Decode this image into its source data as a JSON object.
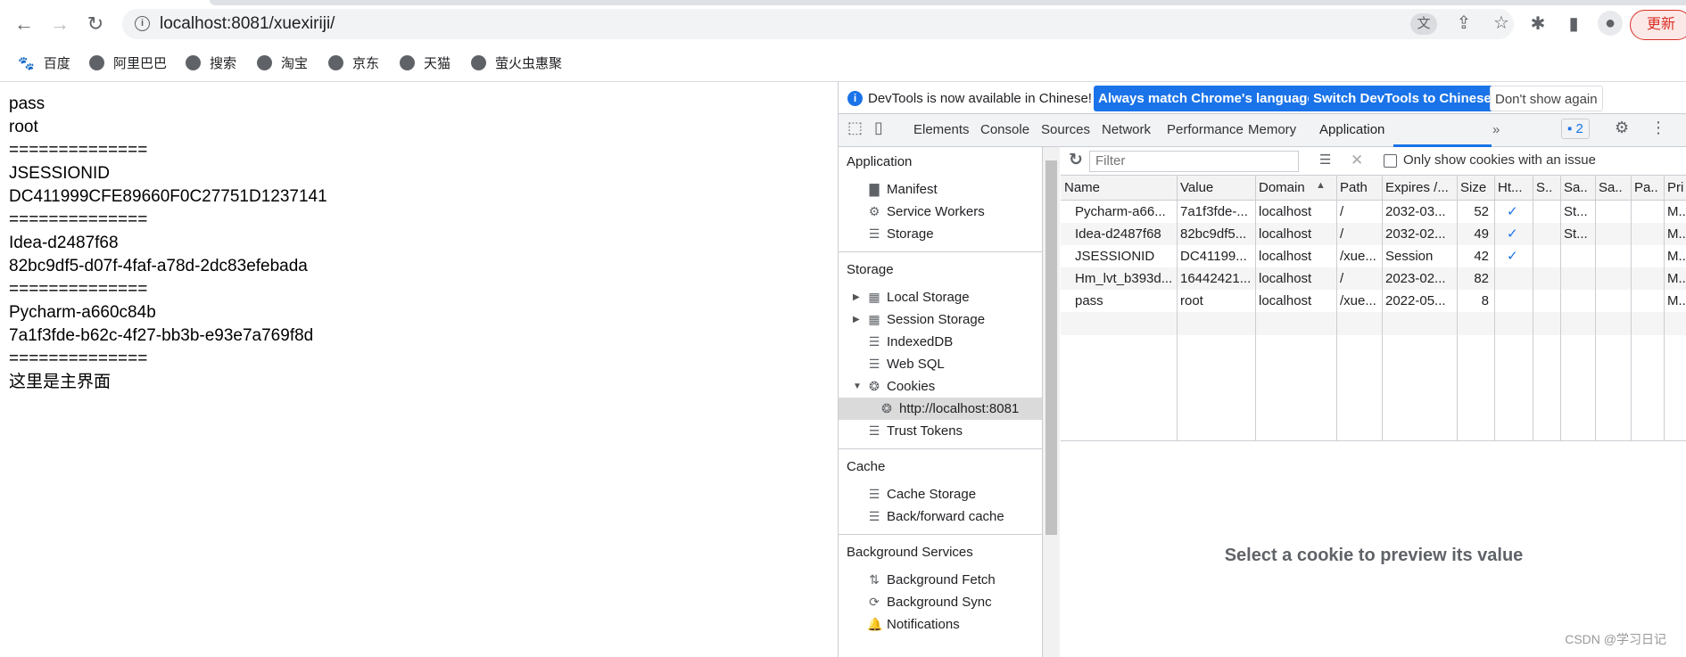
{
  "browser": {
    "url": "localhost:8081/xuexiriji/",
    "update_label": "更新",
    "bookmarks": [
      "百度",
      "阿里巴巴",
      "搜索",
      "淘宝",
      "京东",
      "天猫",
      "萤火虫惠聚"
    ]
  },
  "page": {
    "lines": [
      "pass",
      "root",
      "==============",
      "JSESSIONID",
      "DC411999CFE89660F0C27751D1237141",
      "==============",
      "Idea-d2487f68",
      "82bc9df5-d07f-4faf-a78d-2dc83efebada",
      "==============",
      "Pycharm-a660c84b",
      "7a1f3fde-b62c-4f27-bb3b-e93e7a769f8d",
      "==============",
      "这里是主界面"
    ]
  },
  "devtools": {
    "infobar": {
      "message": "DevTools is now available in Chinese!",
      "btn_match": "Always match Chrome's language",
      "btn_switch": "Switch DevTools to Chinese",
      "btn_dismiss": "Don't show again"
    },
    "tabs": [
      "Elements",
      "Console",
      "Sources",
      "Network",
      "Performance",
      "Memory",
      "Application"
    ],
    "active_tab": "Application",
    "issues_count": "2",
    "accent": "#1a73e8",
    "sidebar": {
      "sections": [
        {
          "title": "Application",
          "items": [
            {
              "label": "Manifest",
              "icon": "file-icon"
            },
            {
              "label": "Service Workers",
              "icon": "gear-icon"
            },
            {
              "label": "Storage",
              "icon": "database-icon"
            }
          ]
        },
        {
          "title": "Storage",
          "items": [
            {
              "label": "Local Storage",
              "icon": "grid-icon",
              "arrow": "▶"
            },
            {
              "label": "Session Storage",
              "icon": "grid-icon",
              "arrow": "▶"
            },
            {
              "label": "IndexedDB",
              "icon": "database-icon"
            },
            {
              "label": "Web SQL",
              "icon": "database-icon"
            },
            {
              "label": "Cookies",
              "icon": "cookie-icon",
              "arrow": "▼"
            },
            {
              "label": "http://localhost:8081",
              "icon": "cookie-icon",
              "child": true,
              "selected": true
            },
            {
              "label": "Trust Tokens",
              "icon": "database-icon"
            }
          ]
        },
        {
          "title": "Cache",
          "items": [
            {
              "label": "Cache Storage",
              "icon": "database-icon"
            },
            {
              "label": "Back/forward cache",
              "icon": "database-icon"
            }
          ]
        },
        {
          "title": "Background Services",
          "items": [
            {
              "label": "Background Fetch",
              "icon": "arrows-updown-icon"
            },
            {
              "label": "Background Sync",
              "icon": "sync-icon"
            },
            {
              "label": "Notifications",
              "icon": "bell-icon"
            }
          ]
        }
      ]
    },
    "cookies": {
      "filter_placeholder": "Filter",
      "only_issues_label": "Only show cookies with an issue",
      "columns": [
        "Name",
        "Value",
        "Domain",
        "Path",
        "Expires /...",
        "Size",
        "Ht...",
        "S..",
        "Sa..",
        "Sa..",
        "Pa..",
        "Pri"
      ],
      "sort_column": "Domain",
      "sort_dir": "ascending",
      "rows": [
        [
          "Pycharm-a66...",
          "7a1f3fde-...",
          "localhost",
          "/",
          "2032-03...",
          "52",
          "✓",
          "",
          "St...",
          "",
          "",
          "M.."
        ],
        [
          "Idea-d2487f68",
          "82bc9df5...",
          "localhost",
          "/",
          "2032-02...",
          "49",
          "✓",
          "",
          "St...",
          "",
          "",
          "M.."
        ],
        [
          "JSESSIONID",
          "DC41199...",
          "localhost",
          "/xue...",
          "Session",
          "42",
          "✓",
          "",
          "",
          "",
          "",
          "M.."
        ],
        [
          "Hm_lvt_b393d...",
          "16442421...",
          "localhost",
          "/",
          "2023-02...",
          "82",
          "",
          "",
          "",
          "",
          "",
          "M.."
        ],
        [
          "pass",
          "root",
          "localhost",
          "/xue...",
          "2022-05...",
          "8",
          "",
          "",
          "",
          "",
          "",
          "M.."
        ]
      ],
      "preview_text": "Select a cookie to preview its value"
    }
  },
  "watermark": "CSDN @学习日记"
}
